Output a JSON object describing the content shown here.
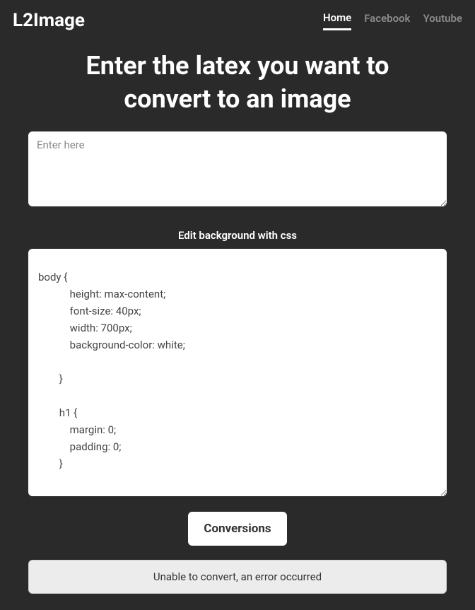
{
  "header": {
    "logo": "L2Image",
    "nav": {
      "home": "Home",
      "facebook": "Facebook",
      "youtube": "Youtube"
    }
  },
  "main": {
    "title": "Enter the latex you want to convert to an image",
    "latex_placeholder": "Enter here",
    "latex_value": "",
    "css_label": "Edit background with css",
    "css_value": "body {\n            height: max-content;\n            font-size: 40px;\n            width: 700px;\n            background-color: white;\n            \n        }\n            \n        h1 {\n            margin: 0;\n            padding: 0;\n        }",
    "convert_button": "Conversions",
    "error_message": "Unable to convert, an error occurred"
  }
}
